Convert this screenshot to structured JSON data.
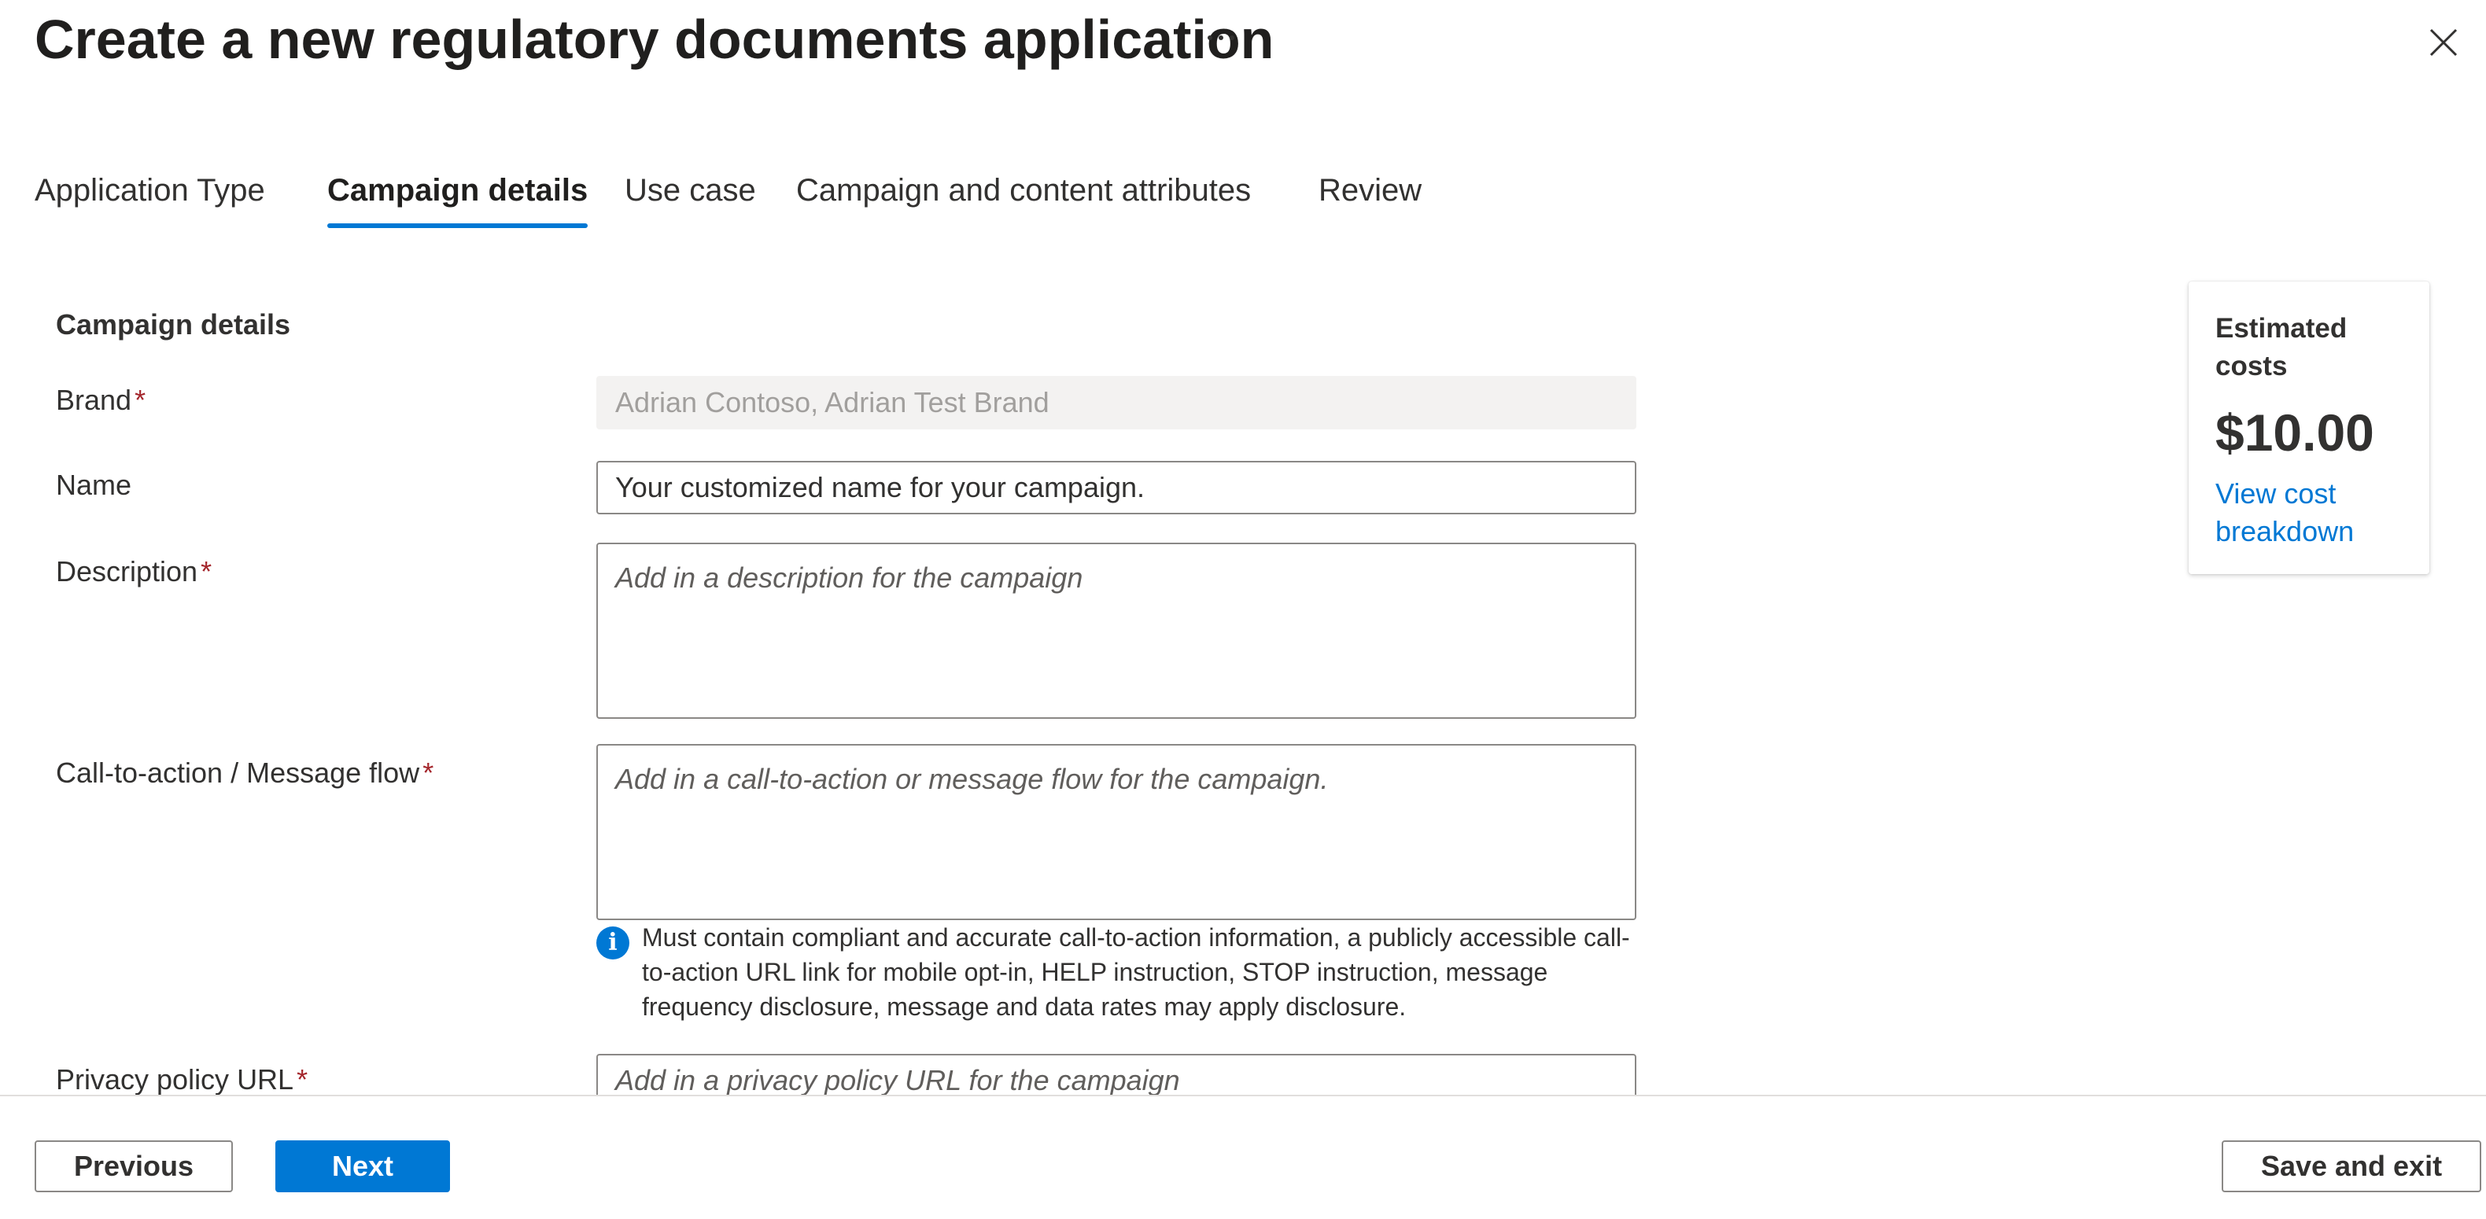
{
  "header": {
    "title": "Create a new regulatory documents application",
    "more_label": "⋯"
  },
  "tabs": [
    {
      "label": "Application Type",
      "active": false
    },
    {
      "label": "Campaign details",
      "active": true
    },
    {
      "label": "Use case",
      "active": false
    },
    {
      "label": "Campaign and content attributes",
      "active": false
    },
    {
      "label": "Review",
      "active": false
    }
  ],
  "form": {
    "section_title": "Campaign details",
    "required_marker": "*",
    "brand": {
      "label": "Brand",
      "value": "Adrian Contoso, Adrian Test Brand"
    },
    "name": {
      "label": "Name",
      "value": "Your customized name for your campaign."
    },
    "description": {
      "label": "Description",
      "placeholder": "Add in a description for the campaign"
    },
    "call_to_action": {
      "label": "Call-to-action / Message flow",
      "placeholder": "Add in a call-to-action or message flow for the campaign.",
      "info_text": "Must contain compliant and accurate call-to-action information, a publicly accessible call-to-action URL link for mobile opt-in, HELP instruction, STOP instruction, message frequency disclosure, message and data rates may apply disclosure."
    },
    "privacy_policy": {
      "label": "Privacy policy URL",
      "placeholder": "Add in a privacy policy URL for the campaign"
    }
  },
  "cost_card": {
    "title": "Estimated costs",
    "amount": "$10.00",
    "link": "View cost breakdown"
  },
  "footer": {
    "previous": "Previous",
    "next": "Next",
    "save_exit": "Save and exit"
  },
  "colors": {
    "accent": "#0078d4",
    "required": "#a4262c"
  }
}
